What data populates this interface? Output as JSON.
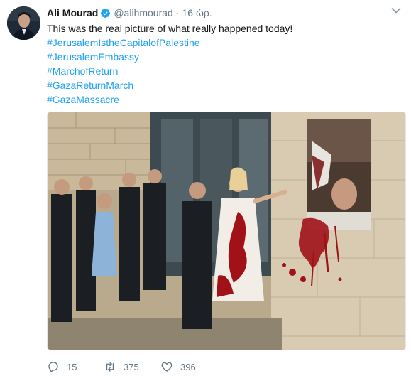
{
  "tweet": {
    "display_name": "Ali Mourad",
    "handle": "@alihmourad",
    "separator": "·",
    "timestamp": "16 ώρ.",
    "text": "This was the real picture of what really happened today!",
    "hashtags": [
      "#JerusalemIstheCapitalofPalestine",
      "#JerusalemEmbassy",
      "#MarchofReturn",
      "#GazaReturnMarch",
      "#GazaMassacre"
    ]
  },
  "actions": {
    "replies": "15",
    "retweets": "375",
    "likes": "396"
  },
  "colors": {
    "link": "#1da1f2",
    "muted": "#657786",
    "verified": "#1da1f2"
  },
  "icons": [
    "verified-badge-icon",
    "chevron-down-icon",
    "reply-icon",
    "retweet-icon",
    "like-icon"
  ]
}
